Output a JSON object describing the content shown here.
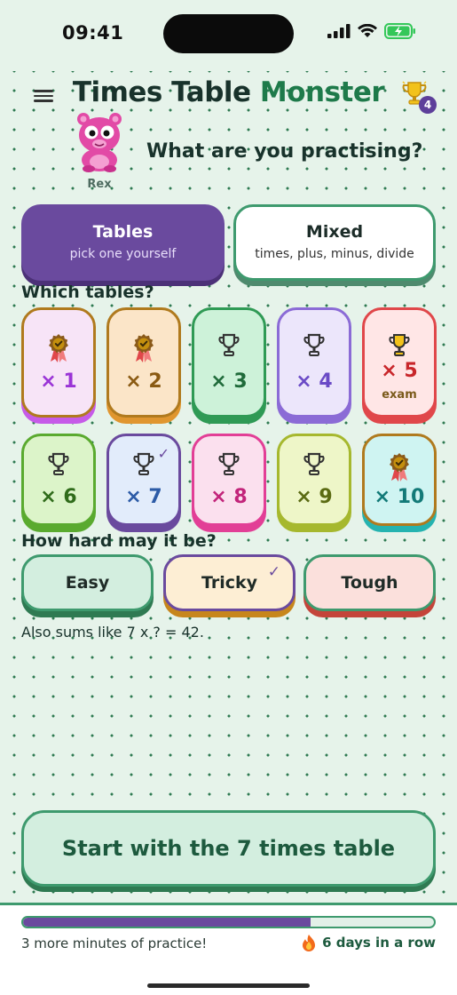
{
  "status": {
    "time": "09:41"
  },
  "header": {
    "title_part1": "Times Table ",
    "title_part2": "Monster",
    "trophy_count": "4",
    "mascot_name": "Rex",
    "question": "What are you practising?"
  },
  "modes": [
    {
      "title": "Tables",
      "subtitle": "pick one yourself",
      "selected": true
    },
    {
      "title": "Mixed",
      "subtitle": "times, plus, minus, divide",
      "selected": false
    }
  ],
  "tables_label": "Which tables?",
  "tables": [
    {
      "label": "× 1",
      "icon": "medal-icon",
      "bg": "#f7e4f7",
      "border": "#b07a1e",
      "shadow": "#c65be8",
      "color": "#9a34d6"
    },
    {
      "label": "× 2",
      "icon": "medal-icon",
      "bg": "#fbe5c8",
      "border": "#b07a1e",
      "shadow": "#e0962f",
      "color": "#8a5a12"
    },
    {
      "label": "× 3",
      "icon": "trophy-icon",
      "bg": "#cdf2d9",
      "border": "#2f9a55",
      "shadow": "#2f9a55",
      "color": "#1f6b3a"
    },
    {
      "label": "× 4",
      "icon": "trophy-icon",
      "bg": "#ece6fb",
      "border": "#8b6bd6",
      "shadow": "#8b6bd6",
      "color": "#6a4ac6"
    },
    {
      "label": "× 5",
      "sub": "exam",
      "icon": "gold-trophy-icon",
      "bg": "#ffe6e6",
      "border": "#e0474a",
      "shadow": "#e0474a",
      "color": "#c8262a"
    },
    {
      "label": "× 6",
      "icon": "trophy-icon",
      "bg": "#dcf4c9",
      "border": "#5aaa2f",
      "shadow": "#5aaa2f",
      "color": "#2f6b1a"
    },
    {
      "label": "× 7",
      "icon": "trophy-icon",
      "bg": "#e2ecfb",
      "border": "#6a4a9e",
      "shadow": "#6a4a9e",
      "color": "#2b5aa6",
      "checked": true
    },
    {
      "label": "× 8",
      "icon": "trophy-icon",
      "bg": "#fbe0ee",
      "border": "#e23f96",
      "shadow": "#e23f96",
      "color": "#c2247a"
    },
    {
      "label": "× 9",
      "icon": "trophy-icon",
      "bg": "#eef6c8",
      "border": "#a6b82e",
      "shadow": "#a6b82e",
      "color": "#5a6a12"
    },
    {
      "label": "× 10",
      "icon": "medal-icon",
      "bg": "#cff4f2",
      "border": "#b07a1e",
      "shadow": "#25b3b0",
      "color": "#137a78"
    }
  ],
  "difficulty_label": "How hard may it be?",
  "difficulties": [
    {
      "label": "Easy",
      "bg": "#d3eedf",
      "border": "#3e9a6e",
      "shadow": "#2f7a52"
    },
    {
      "label": "Tricky",
      "bg": "#fdeed4",
      "border": "#6a4a9e",
      "shadow": "#c7861c",
      "checked": true
    },
    {
      "label": "Tough",
      "bg": "#fbe0dc",
      "border": "#3e9a6e",
      "shadow": "#c4443a"
    }
  ],
  "hint": "Also sums like 7 x ? = 42.",
  "start_label": "Start with the 7 times table",
  "footer": {
    "progress": 0.7,
    "left_text": "3 more minutes of practice!",
    "streak_text": "6 days in a row"
  }
}
